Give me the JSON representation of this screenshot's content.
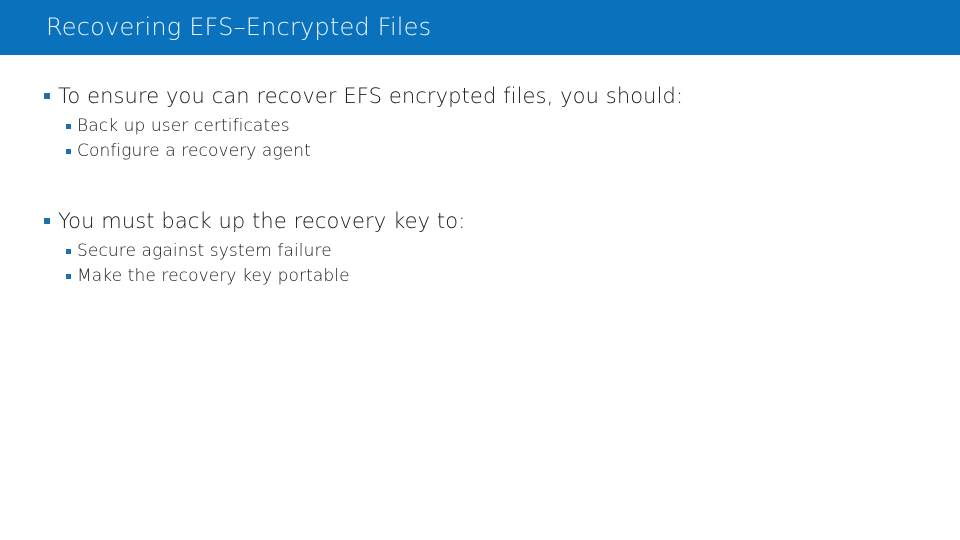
{
  "slide": {
    "title": "Recovering EFS–Encrypted Files",
    "colors": {
      "banner_background": "#0a72bd",
      "title_text": "#eef6fb",
      "body_text": "#1a1a1a",
      "bullet_marker": "#1f6fa8",
      "slide_background": "#ffffff"
    },
    "groups": [
      {
        "heading": "To ensure you can recover EFS encrypted files, you should:",
        "items": [
          "Back up user certificates",
          "Configure a recovery agent"
        ]
      },
      {
        "heading": "You must back up the recovery key to:",
        "items": [
          "Secure against system failure",
          "Make the recovery key portable"
        ]
      }
    ]
  }
}
